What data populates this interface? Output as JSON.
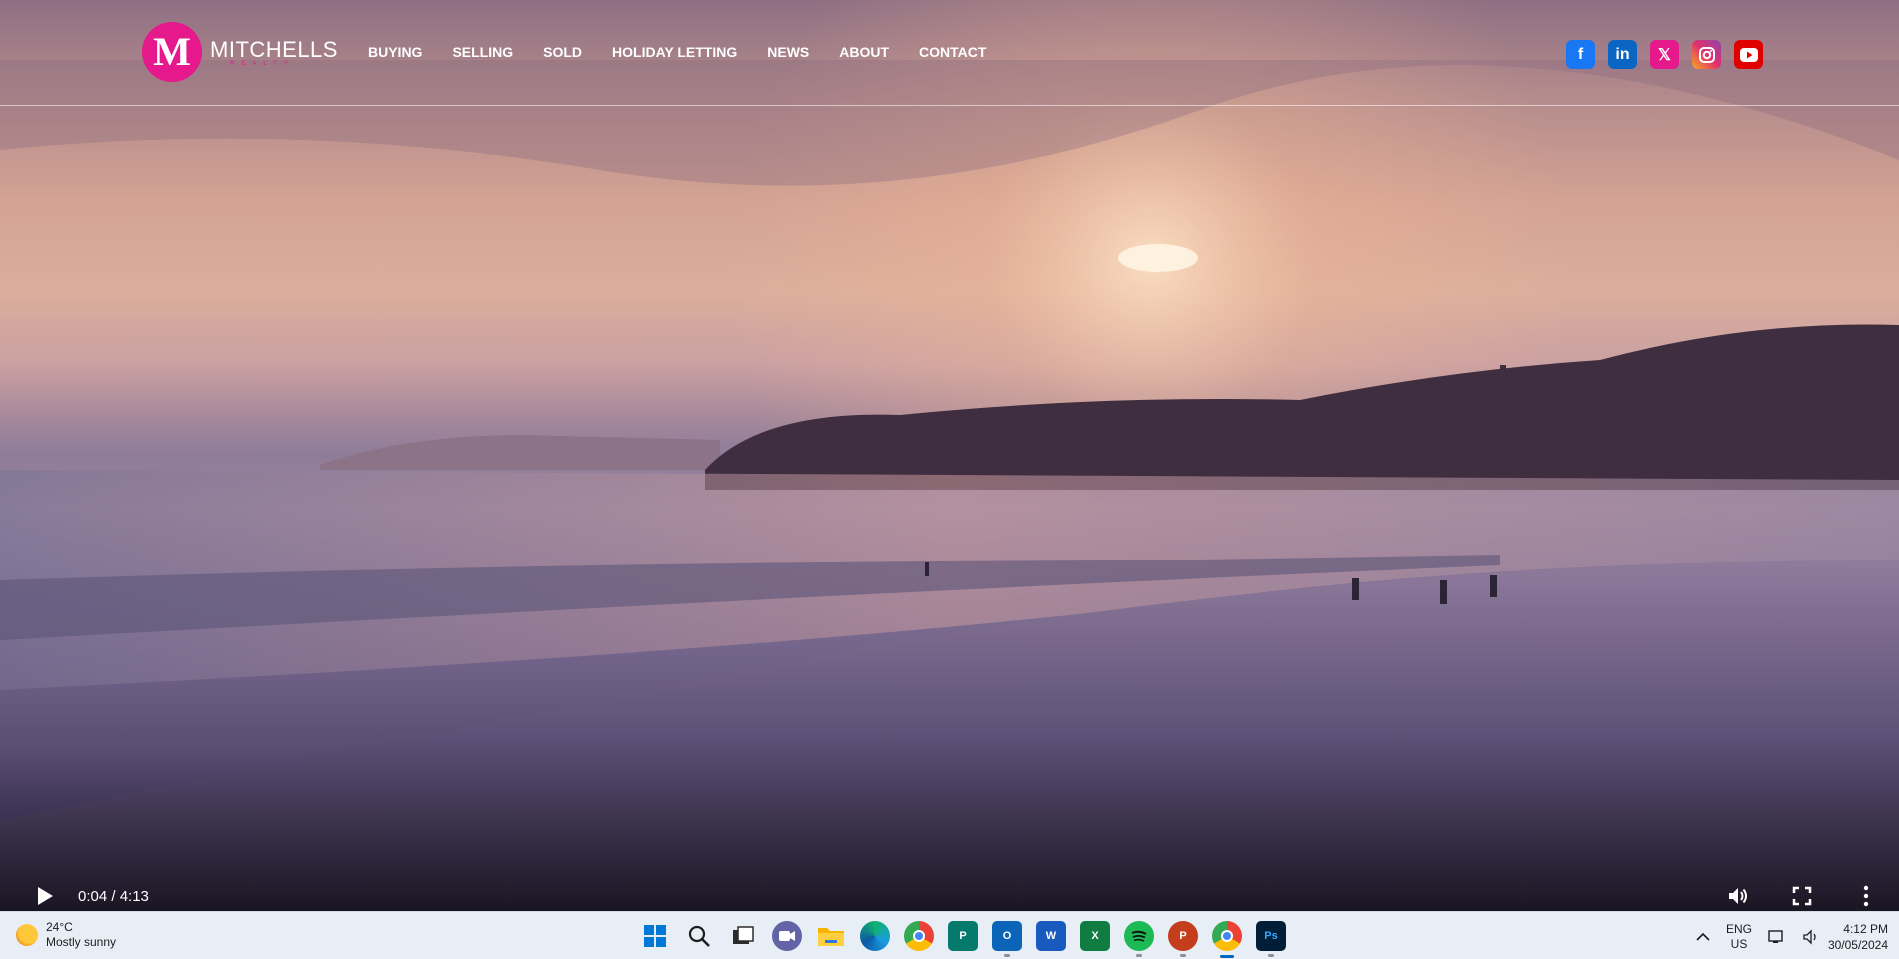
{
  "site": {
    "logo_name": "MITCHELLS",
    "logo_sub": "REALTY",
    "logo_mark": "M",
    "nav": [
      {
        "label": "BUYING"
      },
      {
        "label": "SELLING"
      },
      {
        "label": "SOLD"
      },
      {
        "label": "HOLIDAY LETTING"
      },
      {
        "label": "NEWS"
      },
      {
        "label": "ABOUT"
      },
      {
        "label": "CONTACT"
      }
    ],
    "socials": [
      "facebook-icon",
      "linkedin-icon",
      "x-icon",
      "instagram-icon",
      "youtube-icon"
    ],
    "brand_color": "#e6198c"
  },
  "video": {
    "time": "0:04 / 4:13",
    "progress_fraction": 0.016
  },
  "taskbar": {
    "weather_temp": "24°C",
    "weather_desc": "Mostly sunny",
    "apps": [
      "windows-start-icon",
      "search-icon",
      "task-view-icon",
      "teams-icon",
      "file-explorer-icon",
      "edge-icon",
      "chrome-icon",
      "publisher-icon",
      "outlook-icon",
      "word-icon",
      "excel-icon",
      "spotify-icon",
      "powerpoint-icon",
      "chrome-profile-icon",
      "photoshop-icon"
    ],
    "lang_top": "ENG",
    "lang_bottom": "US",
    "time": "4:12 PM",
    "date": "30/05/2024"
  }
}
